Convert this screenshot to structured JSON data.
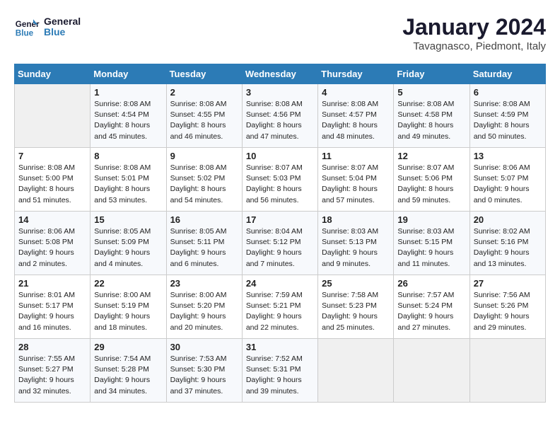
{
  "logo": {
    "text_general": "General",
    "text_blue": "Blue"
  },
  "title": "January 2024",
  "location": "Tavagnasco, Piedmont, Italy",
  "days_of_week": [
    "Sunday",
    "Monday",
    "Tuesday",
    "Wednesday",
    "Thursday",
    "Friday",
    "Saturday"
  ],
  "weeks": [
    [
      {
        "day": "",
        "empty": true
      },
      {
        "day": "1",
        "sunrise": "8:08 AM",
        "sunset": "4:54 PM",
        "daylight": "8 hours and 45 minutes."
      },
      {
        "day": "2",
        "sunrise": "8:08 AM",
        "sunset": "4:55 PM",
        "daylight": "8 hours and 46 minutes."
      },
      {
        "day": "3",
        "sunrise": "8:08 AM",
        "sunset": "4:56 PM",
        "daylight": "8 hours and 47 minutes."
      },
      {
        "day": "4",
        "sunrise": "8:08 AM",
        "sunset": "4:57 PM",
        "daylight": "8 hours and 48 minutes."
      },
      {
        "day": "5",
        "sunrise": "8:08 AM",
        "sunset": "4:58 PM",
        "daylight": "8 hours and 49 minutes."
      },
      {
        "day": "6",
        "sunrise": "8:08 AM",
        "sunset": "4:59 PM",
        "daylight": "8 hours and 50 minutes."
      }
    ],
    [
      {
        "day": "7",
        "sunrise": "8:08 AM",
        "sunset": "5:00 PM",
        "daylight": "8 hours and 51 minutes."
      },
      {
        "day": "8",
        "sunrise": "8:08 AM",
        "sunset": "5:01 PM",
        "daylight": "8 hours and 53 minutes."
      },
      {
        "day": "9",
        "sunrise": "8:08 AM",
        "sunset": "5:02 PM",
        "daylight": "8 hours and 54 minutes."
      },
      {
        "day": "10",
        "sunrise": "8:07 AM",
        "sunset": "5:03 PM",
        "daylight": "8 hours and 56 minutes."
      },
      {
        "day": "11",
        "sunrise": "8:07 AM",
        "sunset": "5:04 PM",
        "daylight": "8 hours and 57 minutes."
      },
      {
        "day": "12",
        "sunrise": "8:07 AM",
        "sunset": "5:06 PM",
        "daylight": "8 hours and 59 minutes."
      },
      {
        "day": "13",
        "sunrise": "8:06 AM",
        "sunset": "5:07 PM",
        "daylight": "9 hours and 0 minutes."
      }
    ],
    [
      {
        "day": "14",
        "sunrise": "8:06 AM",
        "sunset": "5:08 PM",
        "daylight": "9 hours and 2 minutes."
      },
      {
        "day": "15",
        "sunrise": "8:05 AM",
        "sunset": "5:09 PM",
        "daylight": "9 hours and 4 minutes."
      },
      {
        "day": "16",
        "sunrise": "8:05 AM",
        "sunset": "5:11 PM",
        "daylight": "9 hours and 6 minutes."
      },
      {
        "day": "17",
        "sunrise": "8:04 AM",
        "sunset": "5:12 PM",
        "daylight": "9 hours and 7 minutes."
      },
      {
        "day": "18",
        "sunrise": "8:03 AM",
        "sunset": "5:13 PM",
        "daylight": "9 hours and 9 minutes."
      },
      {
        "day": "19",
        "sunrise": "8:03 AM",
        "sunset": "5:15 PM",
        "daylight": "9 hours and 11 minutes."
      },
      {
        "day": "20",
        "sunrise": "8:02 AM",
        "sunset": "5:16 PM",
        "daylight": "9 hours and 13 minutes."
      }
    ],
    [
      {
        "day": "21",
        "sunrise": "8:01 AM",
        "sunset": "5:17 PM",
        "daylight": "9 hours and 16 minutes."
      },
      {
        "day": "22",
        "sunrise": "8:00 AM",
        "sunset": "5:19 PM",
        "daylight": "9 hours and 18 minutes."
      },
      {
        "day": "23",
        "sunrise": "8:00 AM",
        "sunset": "5:20 PM",
        "daylight": "9 hours and 20 minutes."
      },
      {
        "day": "24",
        "sunrise": "7:59 AM",
        "sunset": "5:21 PM",
        "daylight": "9 hours and 22 minutes."
      },
      {
        "day": "25",
        "sunrise": "7:58 AM",
        "sunset": "5:23 PM",
        "daylight": "9 hours and 25 minutes."
      },
      {
        "day": "26",
        "sunrise": "7:57 AM",
        "sunset": "5:24 PM",
        "daylight": "9 hours and 27 minutes."
      },
      {
        "day": "27",
        "sunrise": "7:56 AM",
        "sunset": "5:26 PM",
        "daylight": "9 hours and 29 minutes."
      }
    ],
    [
      {
        "day": "28",
        "sunrise": "7:55 AM",
        "sunset": "5:27 PM",
        "daylight": "9 hours and 32 minutes."
      },
      {
        "day": "29",
        "sunrise": "7:54 AM",
        "sunset": "5:28 PM",
        "daylight": "9 hours and 34 minutes."
      },
      {
        "day": "30",
        "sunrise": "7:53 AM",
        "sunset": "5:30 PM",
        "daylight": "9 hours and 37 minutes."
      },
      {
        "day": "31",
        "sunrise": "7:52 AM",
        "sunset": "5:31 PM",
        "daylight": "9 hours and 39 minutes."
      },
      {
        "day": "",
        "empty": true
      },
      {
        "day": "",
        "empty": true
      },
      {
        "day": "",
        "empty": true
      }
    ]
  ],
  "labels": {
    "sunrise_prefix": "Sunrise: ",
    "sunset_prefix": "Sunset: ",
    "daylight_prefix": "Daylight: "
  }
}
